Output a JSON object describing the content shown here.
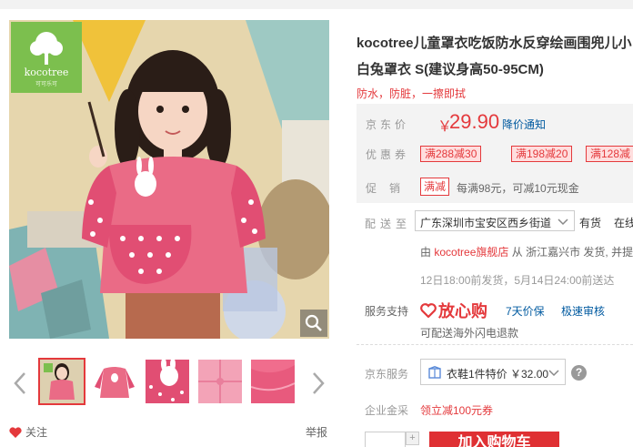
{
  "product": {
    "title": "kocotree儿童罩衣吃饭防水反穿绘画围兜儿小白兔罩衣 S(建议身高50-95CM)",
    "slogan": "防水，防脏，一擦即拭"
  },
  "gallery": {
    "logo_text": "kocotree",
    "logo_sub": "可可乐可",
    "thumbnail_count": 5,
    "active_thumbnail": 1
  },
  "actions": {
    "follow": "关注",
    "report": "举报"
  },
  "price": {
    "label": "京东价",
    "symbol": "￥",
    "value": "29.90",
    "notify": "降价通知"
  },
  "coupons": {
    "label": "优惠券",
    "items": [
      "满288减30",
      "满198减20",
      "满128减"
    ]
  },
  "promotion": {
    "label": "促销",
    "tag": "满减",
    "text": "每满98元，可减10元现金"
  },
  "shipping": {
    "label": "配送至",
    "address": "广东深圳市宝安区西乡街道",
    "stock": "有货",
    "stock_extra": "在线",
    "seller_prefix": "由",
    "shop": "kocotree旗舰店",
    "seller_suffix": "从 浙江嘉兴市 发货, 并提",
    "delivery": "12日18:00前发货，5月14日24:00前送达"
  },
  "service": {
    "label": "服务支持",
    "brand": "放心购",
    "links": [
      "7天价保",
      "极速审核"
    ],
    "sub": "可配送海外闪电退款"
  },
  "jd_service": {
    "label": "京东服务",
    "option": "衣鞋1件特价 ￥32.00",
    "help": "?"
  },
  "enterprise": {
    "label": "企业金采",
    "link": "领立减100元券"
  },
  "purchase": {
    "qty_up": "+",
    "cart": "加入购物车"
  },
  "colors": {
    "accent": "#e4393c",
    "link": "#005aa0",
    "logo_green": "#7cbf4e"
  }
}
